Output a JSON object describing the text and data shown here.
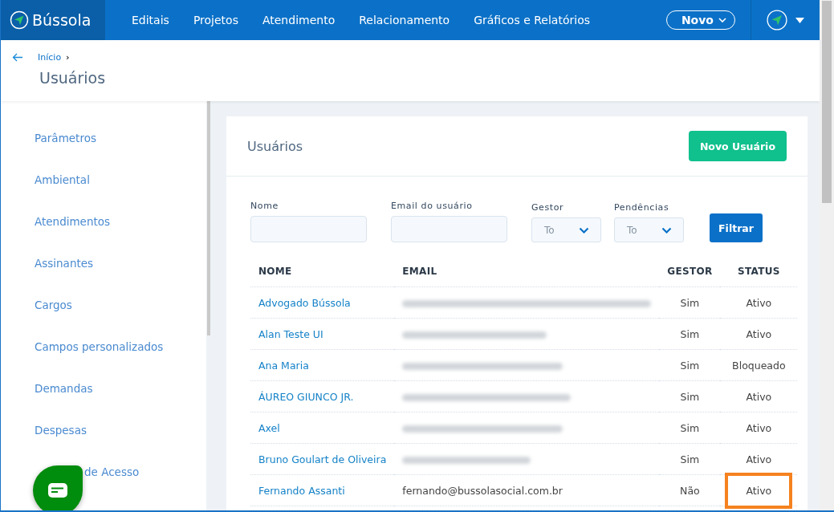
{
  "header": {
    "logo": "Bússola",
    "nav": [
      {
        "label": "Editais"
      },
      {
        "label": "Projetos"
      },
      {
        "label": "Atendimento"
      },
      {
        "label": "Relacionamento"
      },
      {
        "label": "Gráficos e Relatórios"
      }
    ],
    "new_button": "Novo"
  },
  "breadcrumb": {
    "items": [
      "Início"
    ],
    "separator": "›",
    "title": "Usuários"
  },
  "sidebar": {
    "items": [
      {
        "label": "Parâmetros"
      },
      {
        "label": "Ambiental"
      },
      {
        "label": "Atendimentos"
      },
      {
        "label": "Assinantes"
      },
      {
        "label": "Cargos"
      },
      {
        "label": "Campos personalizados"
      },
      {
        "label": "Demandas"
      },
      {
        "label": "Despesas"
      },
      {
        "label": "de Acesso"
      }
    ]
  },
  "card": {
    "title": "Usuários",
    "new_user_button": "Novo Usuário",
    "filters": [
      {
        "kind": "text",
        "label": "Nome"
      },
      {
        "kind": "text",
        "label": "Email do usuário"
      },
      {
        "kind": "select",
        "label": "Gestor",
        "placeholder": "To"
      },
      {
        "kind": "select",
        "label": "Pendências",
        "placeholder": "To"
      }
    ],
    "filter_button": "Filtrar",
    "table": {
      "columns": [
        "NOME",
        "EMAIL",
        "GESTOR",
        "STATUS"
      ],
      "rows": [
        {
          "name": "Advogado Bússola",
          "email_redacted": true,
          "gestor": "Sim",
          "status": "Ativo",
          "highlighted": false
        },
        {
          "name": "Alan Teste UI",
          "email_redacted": true,
          "gestor": "Sim",
          "status": "Ativo",
          "highlighted": false
        },
        {
          "name": "Ana Maria",
          "email_redacted": true,
          "gestor": "Sim",
          "status": "Bloqueado",
          "highlighted": false
        },
        {
          "name": "ÁUREO GIUNCO JR.",
          "email_redacted": true,
          "gestor": "Sim",
          "status": "Ativo",
          "highlighted": false
        },
        {
          "name": "Axel",
          "email_redacted": true,
          "gestor": "Sim",
          "status": "Ativo",
          "highlighted": false
        },
        {
          "name": "Bruno Goulart de Oliveira",
          "email_redacted": true,
          "gestor": "Sim",
          "status": "Ativo",
          "highlighted": false
        },
        {
          "name": "Fernando Assanti",
          "email": "fernando@bussolasocial.com.br",
          "gestor": "Não",
          "status": "Ativo",
          "highlighted": true
        }
      ]
    }
  }
}
